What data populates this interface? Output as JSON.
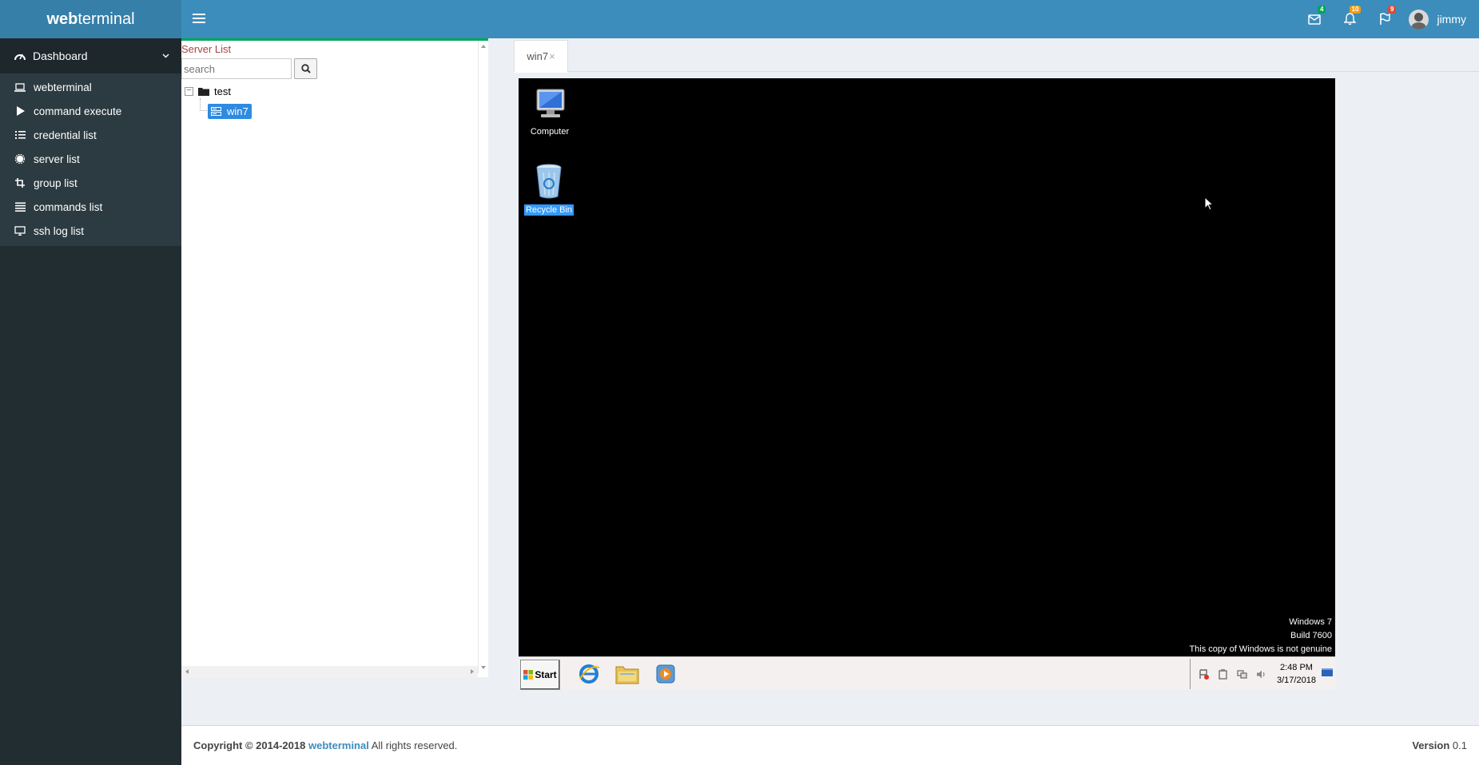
{
  "header": {
    "logo_bold": "web",
    "logo_rest": "terminal",
    "badges": {
      "messages": "4",
      "notifications": "10",
      "tasks": "9"
    },
    "user_name": "jimmy"
  },
  "sidebar": {
    "section_label": "Dashboard",
    "items": [
      {
        "label": "webterminal",
        "icon": "laptop-icon"
      },
      {
        "label": "command execute",
        "icon": "play-icon"
      },
      {
        "label": "credential list",
        "icon": "list-ol-icon"
      },
      {
        "label": "server list",
        "icon": "gear-icon"
      },
      {
        "label": "group list",
        "icon": "crop-icon"
      },
      {
        "label": "commands list",
        "icon": "list-icon"
      },
      {
        "label": "ssh log list",
        "icon": "desktop-icon"
      }
    ]
  },
  "server_panel": {
    "title": "Server List",
    "search_placeholder": "search",
    "group": "test",
    "server": "win7"
  },
  "tabs": [
    {
      "label": "win7",
      "close": "×"
    }
  ],
  "remote_desktop": {
    "icons": {
      "computer": "Computer",
      "recycle_bin": "Recycle Bin"
    },
    "watermark": [
      "Windows 7",
      "Build 7600",
      "This copy of Windows is not genuine"
    ],
    "start_label": "Start",
    "clock_time": "2:48 PM",
    "clock_date": "3/17/2018"
  },
  "footer": {
    "copyright_prefix": "Copyright © 2014-2018",
    "brand": "webterminal",
    "rights": "All rights reserved.",
    "version_label": "Version",
    "version": "0.1"
  },
  "colors": {
    "header": "#3c8dbc",
    "logo": "#367fa9",
    "sidebar": "#222d32",
    "panel_accent": "#00a65a",
    "tree_selected": "#2e8be0"
  }
}
